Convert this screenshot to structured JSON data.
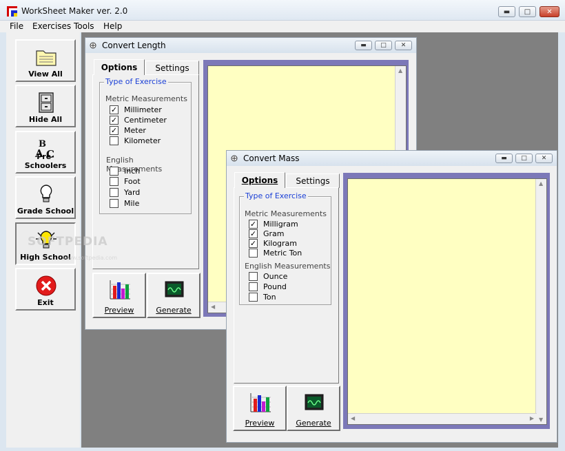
{
  "app": {
    "title": "WorkSheet Maker ver. 2.0",
    "window_controls": {
      "minimize": "▬",
      "maximize": "□",
      "close": "✕"
    }
  },
  "menu": [
    "File",
    "Exercises",
    "Tools",
    "Help"
  ],
  "toolbar": [
    {
      "label": "View All",
      "icon": "folder-icon"
    },
    {
      "label": "Hide All",
      "icon": "cabinet-icon"
    },
    {
      "label": "Pre-Schoolers",
      "icon": "abc-blocks-icon"
    },
    {
      "label": "Grade School",
      "icon": "lightbulb-icon"
    },
    {
      "label": "High School",
      "icon": "lightbulb-lit-icon",
      "pressed": true
    },
    {
      "label": "Exit",
      "icon": "exit-icon"
    }
  ],
  "watermark": {
    "text": "SOFTPEDIA",
    "sub": "www.softpedia.com"
  },
  "length_window": {
    "title": "Convert Length",
    "tabs": [
      "Options",
      "Settings"
    ],
    "active_tab": "Options",
    "group_title": "Type of Exercise",
    "metric_heading": "Metric Measurements",
    "metric": [
      {
        "label": "Millimeter",
        "checked": true
      },
      {
        "label": "Centimeter",
        "checked": true
      },
      {
        "label": "Meter",
        "checked": true
      },
      {
        "label": "Kilometer",
        "checked": false
      }
    ],
    "english_heading": "English Measurements",
    "english": [
      {
        "label": "Inch",
        "checked": false
      },
      {
        "label": "Foot",
        "checked": false
      },
      {
        "label": "Yard",
        "checked": false
      },
      {
        "label": "Mile",
        "checked": false
      }
    ],
    "preview_label": "Preview",
    "generate_label": "Generate"
  },
  "mass_window": {
    "title": "Convert Mass",
    "tabs": [
      "Options",
      "Settings"
    ],
    "active_tab": "Options",
    "group_title": "Type of Exercise",
    "metric_heading": "Metric Measurements",
    "metric": [
      {
        "label": "Milligram",
        "checked": true
      },
      {
        "label": "Gram",
        "checked": true
      },
      {
        "label": "Kilogram",
        "checked": true
      },
      {
        "label": "Metric Ton",
        "checked": false
      }
    ],
    "english_heading": "English Measurements",
    "english": [
      {
        "label": "Ounce",
        "checked": false
      },
      {
        "label": "Pound",
        "checked": false
      },
      {
        "label": "Ton",
        "checked": false
      }
    ],
    "preview_label": "Preview",
    "generate_label": "Generate"
  },
  "colors": {
    "mdi_background": "#808080",
    "editor_background": "#ffffc2",
    "editor_frame": "#7c78b8",
    "group_title": "#1a3fd6"
  }
}
